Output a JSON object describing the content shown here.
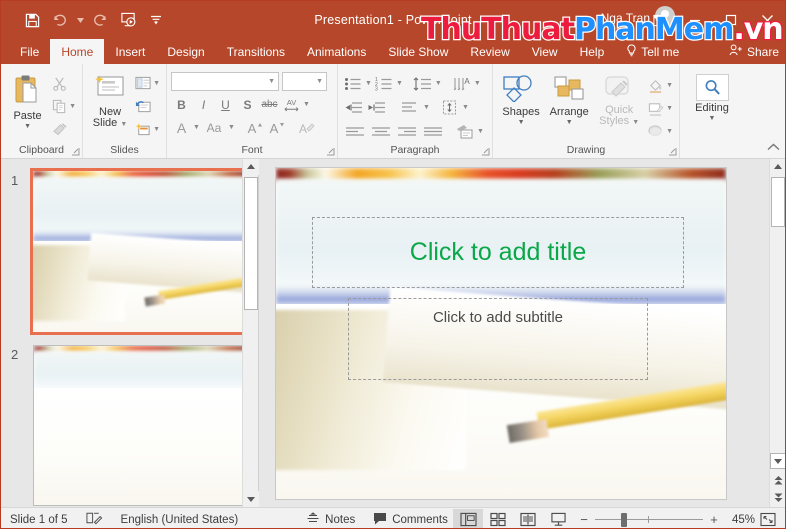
{
  "app": {
    "title": "Presentation1  -  PowerPoint",
    "account_name": "Nga Tran",
    "accent_color": "#b7472a"
  },
  "watermark": {
    "part1": "ThuThuat",
    "part2": "PhanMem",
    "part3": ".vn"
  },
  "quick_access": [
    {
      "name": "save-icon",
      "label": "Save"
    },
    {
      "name": "undo-icon",
      "label": "Undo"
    },
    {
      "name": "redo-icon",
      "label": "Redo"
    },
    {
      "name": "start-presentation-icon",
      "label": "Start From Beginning"
    },
    {
      "name": "customize-quick-access-icon",
      "label": "Customize Quick Access Toolbar"
    }
  ],
  "window_controls": [
    {
      "name": "minimize-icon",
      "glyph": "–"
    },
    {
      "name": "restore-icon",
      "glyph": "❐"
    },
    {
      "name": "close-icon",
      "glyph": "✕"
    }
  ],
  "tabs": [
    {
      "label": "File",
      "active": false
    },
    {
      "label": "Home",
      "active": true
    },
    {
      "label": "Insert",
      "active": false
    },
    {
      "label": "Design",
      "active": false
    },
    {
      "label": "Transitions",
      "active": false
    },
    {
      "label": "Animations",
      "active": false
    },
    {
      "label": "Slide Show",
      "active": false
    },
    {
      "label": "Review",
      "active": false
    },
    {
      "label": "View",
      "active": false
    },
    {
      "label": "Help",
      "active": false
    }
  ],
  "tabs_right": {
    "tell_me": "Tell me",
    "share": "Share"
  },
  "ribbon": {
    "clipboard": {
      "label": "Clipboard",
      "paste": "Paste",
      "cut": "Cut",
      "copy": "Copy",
      "format_painter": "Format Painter"
    },
    "slides": {
      "label": "Slides",
      "new_slide_line1": "New",
      "new_slide_line2": "Slide",
      "layout": "Layout",
      "reset": "Reset",
      "section": "Section"
    },
    "font": {
      "label": "Font",
      "font_name_value": "",
      "font_name_placeholder": "",
      "font_size_value": "",
      "bold": "B",
      "italic": "I",
      "underline": "U",
      "shadow": "S",
      "strikethrough": "abc",
      "character_spacing": "AV",
      "font_color": "A",
      "change_case": "Aa",
      "increase_font": "A",
      "decrease_font": "A",
      "clear_formatting": "Clear All Formatting"
    },
    "paragraph": {
      "label": "Paragraph",
      "bullets": "Bullets",
      "numbering": "Numbering",
      "line_spacing": "Line Spacing",
      "text_direction": "Text Direction",
      "decrease_indent": "Decrease List Level",
      "increase_indent": "Increase List Level",
      "align_text": "Align Text",
      "columns": "Columns",
      "align_left": "Align Left",
      "align_center": "Center",
      "align_right": "Align Right",
      "justify": "Justify",
      "smartart": "Convert to SmartArt"
    },
    "drawing": {
      "label": "Drawing",
      "shapes": "Shapes",
      "arrange": "Arrange",
      "quick_styles_line1": "Quick",
      "quick_styles_line2": "Styles",
      "shape_fill": "Shape Fill",
      "shape_outline": "Shape Outline",
      "shape_effects": "Shape Effects"
    },
    "editing": {
      "label": "",
      "editing": "Editing"
    },
    "collapse": "Collapse the Ribbon"
  },
  "thumbnails": [
    {
      "number": "1",
      "selected": true
    },
    {
      "number": "2",
      "selected": false
    }
  ],
  "slide": {
    "title_placeholder": "Click to add title",
    "subtitle_placeholder": "Click to add subtitle",
    "title_color": "#0ba84a"
  },
  "status": {
    "slide_indicator": "Slide 1 of 5",
    "accessibility": "Accessibility",
    "language": "English (United States)",
    "notes": "Notes",
    "comments": "Comments",
    "views": [
      {
        "name": "normal-view",
        "active": true
      },
      {
        "name": "slide-sorter-view",
        "active": false
      },
      {
        "name": "reading-view",
        "active": false
      },
      {
        "name": "slide-show-view",
        "active": false
      }
    ],
    "zoom_out": "−",
    "zoom_in": "+",
    "zoom_percent": "45%",
    "fit_to_window": "Fit slide to current window"
  }
}
